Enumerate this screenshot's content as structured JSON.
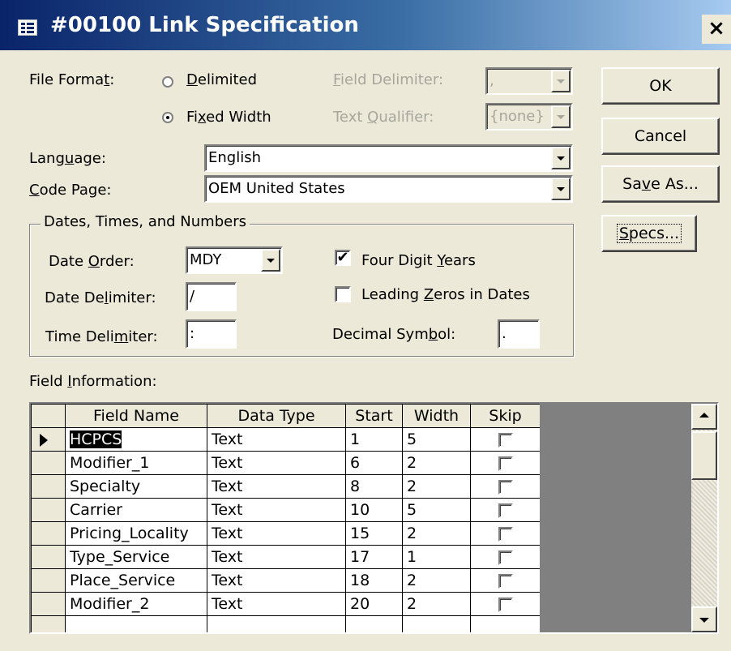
{
  "window": {
    "title": "#00100 Link Specification",
    "close_label": "×"
  },
  "file_format": {
    "label": "File Format:",
    "delimited_label": "Delimited",
    "fixed_width_label": "Fixed Width",
    "selected": "Fixed Width"
  },
  "field_delimiter": {
    "label": "Field Delimiter:",
    "value": ","
  },
  "text_qualifier": {
    "label": "Text Qualifier:",
    "value": "{none}"
  },
  "language": {
    "label": "Language:",
    "value": "English"
  },
  "code_page": {
    "label": "Code Page:",
    "value": "OEM United States"
  },
  "buttons": {
    "ok": "OK",
    "cancel": "Cancel",
    "save_as": "Save As...",
    "specs": "Specs..."
  },
  "dates_group": {
    "legend": "Dates, Times, and Numbers",
    "date_order": {
      "label": "Date Order:",
      "value": "MDY"
    },
    "date_delimiter": {
      "label": "Date Delimiter:",
      "value": "/"
    },
    "time_delimiter": {
      "label": "Time Delimiter:",
      "value": ":"
    },
    "four_digit_years": {
      "label": "Four Digit Years",
      "checked": true
    },
    "leading_zeros": {
      "label": "Leading Zeros in Dates",
      "checked": false
    },
    "decimal_symbol": {
      "label": "Decimal Symbol:",
      "value": "."
    }
  },
  "field_info": {
    "label": "Field Information:",
    "columns": [
      "Field Name",
      "Data Type",
      "Start",
      "Width",
      "Skip"
    ],
    "rows": [
      {
        "name": "HCPCS",
        "type": "Text",
        "start": "1",
        "width": "5",
        "skip": false
      },
      {
        "name": "Modifier_1",
        "type": "Text",
        "start": "6",
        "width": "2",
        "skip": false
      },
      {
        "name": "Specialty",
        "type": "Text",
        "start": "8",
        "width": "2",
        "skip": false
      },
      {
        "name": "Carrier",
        "type": "Text",
        "start": "10",
        "width": "5",
        "skip": false
      },
      {
        "name": "Pricing_Locality",
        "type": "Text",
        "start": "15",
        "width": "2",
        "skip": false
      },
      {
        "name": "Type_Service",
        "type": "Text",
        "start": "17",
        "width": "1",
        "skip": false
      },
      {
        "name": "Place_Service",
        "type": "Text",
        "start": "18",
        "width": "2",
        "skip": false
      },
      {
        "name": "Modifier_2",
        "type": "Text",
        "start": "20",
        "width": "2",
        "skip": false
      }
    ]
  },
  "colors": {
    "title_bar": "#0a246a",
    "face": "#ece9d8",
    "grid_empty": "#808080"
  }
}
